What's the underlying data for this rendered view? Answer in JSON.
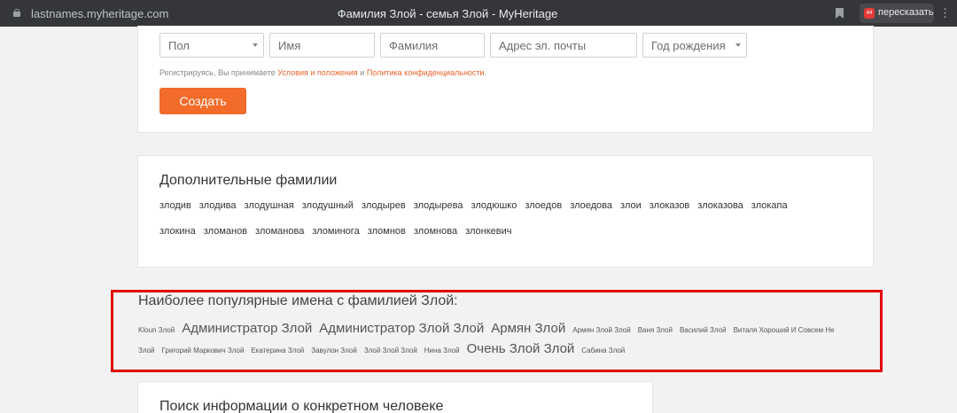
{
  "browser": {
    "url": "lastnames.myheritage.com",
    "title": "Фамилия Злой - семья Злой - MyHeritage",
    "retell_badge": "44",
    "retell_label": "пересказать",
    "menu_glyph": "⋮"
  },
  "form": {
    "gender_placeholder": "Пол",
    "first_name_placeholder": "Имя",
    "last_name_placeholder": "Фамилия",
    "email_placeholder": "Адрес эл. почты",
    "birth_year_placeholder": "Год рождения",
    "terms_prefix": "Регистрируясь, Вы принимаете ",
    "terms_link": "Условия и положения",
    "terms_and": " и ",
    "privacy_link": "Политика конфиденциальности",
    "terms_suffix": ".",
    "create_label": "Создать"
  },
  "additional_surnames": {
    "title": "Дополнительные фамилии",
    "row1": [
      "злодив",
      "злодива",
      "злодушная",
      "злодушный",
      "злодырев",
      "злодырева",
      "злодюшко",
      "злоедов",
      "злоедова",
      "злои",
      "злоказов",
      "злоказова",
      "злокапа"
    ],
    "row2": [
      "злокина",
      "зломанов",
      "зломанова",
      "зломинога",
      "зломнов",
      "зломнова",
      "злонкевич"
    ]
  },
  "popular_names": {
    "title": "Наиболее популярные имена с фамилией Злой:",
    "row1": [
      {
        "text": "Kloun Злой",
        "size": "s"
      },
      {
        "text": "Администратор Злой",
        "size": "l"
      },
      {
        "text": "Администратор Злой Злой",
        "size": "l"
      },
      {
        "text": "Армян Злой",
        "size": "l"
      },
      {
        "text": "Армян Злой Злой",
        "size": "s"
      },
      {
        "text": "Ваня Злой",
        "size": "s"
      },
      {
        "text": "Василий Злой",
        "size": "s"
      },
      {
        "text": "Виталя Хороший И Совсем Не",
        "size": "s"
      }
    ],
    "row2": [
      {
        "text": "Злой",
        "size": "s"
      },
      {
        "text": "Григорий Маркович Злой",
        "size": "s"
      },
      {
        "text": "Екатерина Злой",
        "size": "s"
      },
      {
        "text": "Завулон Злой",
        "size": "s"
      },
      {
        "text": "Злой Злой Злой",
        "size": "s"
      },
      {
        "text": "Нина Злой",
        "size": "s"
      },
      {
        "text": "Очень Злой Злой",
        "size": "l"
      },
      {
        "text": "Сабина Злой",
        "size": "s"
      }
    ]
  },
  "search_section": {
    "title": "Поиск информации о конкретном человеке"
  },
  "colors": {
    "accent": "#f26b2a",
    "highlight": "#e00000"
  }
}
